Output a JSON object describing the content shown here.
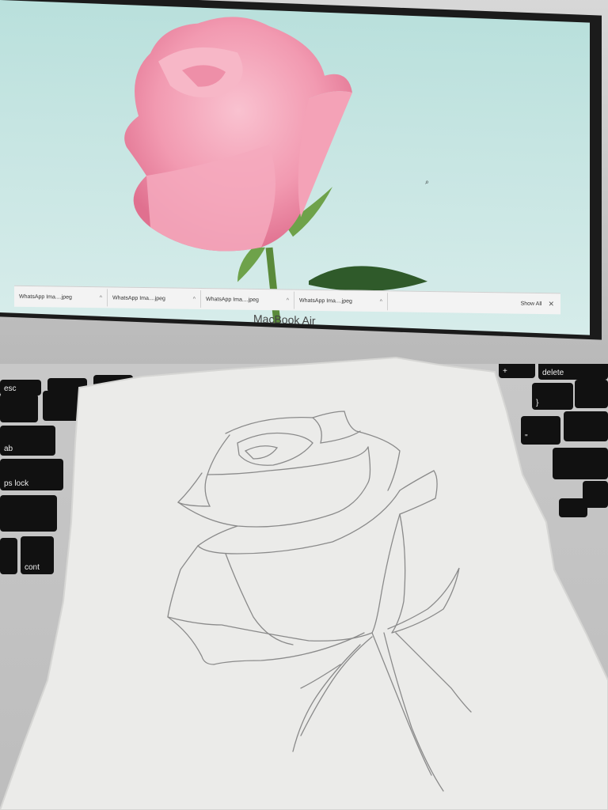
{
  "laptop": {
    "brand_label": "MacBook Air",
    "downloads": [
      {
        "label": "WhatsApp Ima....jpeg"
      },
      {
        "label": "WhatsApp Ima....jpeg"
      },
      {
        "label": "WhatsApp Ima....jpeg"
      },
      {
        "label": "WhatsApp Ima....jpeg"
      }
    ],
    "show_all_label": "Show All",
    "close_label": "✕"
  },
  "keyboard": {
    "keys": [
      "esc",
      "delete",
      "ab",
      "ps lock",
      "cont",
      "+",
      "=",
      "}",
      "]",
      "\"",
      "?",
      "/"
    ]
  },
  "colors": {
    "screen_bg": "#c6e5e2",
    "rose": "#f2a3b8",
    "paper": "#ebebe9",
    "pencil": "#8a8a8a"
  }
}
